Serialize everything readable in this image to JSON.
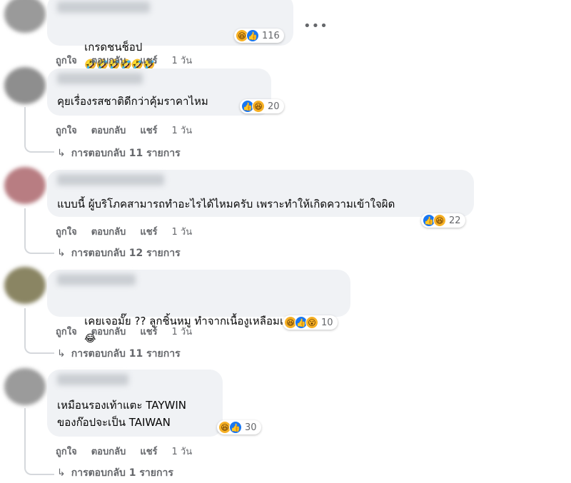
{
  "actions": {
    "like": "ถูกใจ",
    "reply": "ตอบกลับ",
    "share": "แชร์"
  },
  "comments": [
    {
      "text": "เกรดชนช็อป",
      "emoji": "🤣🤣🤣🤣🤣🤣",
      "reaction_count": "116",
      "time": "1 วัน",
      "replies": ""
    },
    {
      "text": "คุยเรื่องรสชาติดีกว่าคุ้มราคาไหม",
      "reaction_count": "20",
      "time": "1 วัน",
      "replies": "การตอบกลับ 11 รายการ"
    },
    {
      "text": "แบบนี้ ผู้บริโภคสามารถทำอะไรได้ไหมครับ เพราะทำให้เกิดความเข้าใจผิด",
      "reaction_count": "22",
      "time": "1 วัน",
      "replies": "การตอบกลับ 12 รายการ"
    },
    {
      "text": "เคยเจอมั๊ย ?? ลูกชิ้นหมู ทำจากเนื้องูเหลือมแท้ๆ",
      "emoji": "😂",
      "reaction_count": "10",
      "time": "1 วัน",
      "replies": "การตอบกลับ 11 รายการ"
    },
    {
      "text_line1": "เหมือนรองเท้าแตะ TAYWIN",
      "text_line2": "ของก๊อปจะเป็น TAIWAN",
      "reaction_count": "30",
      "time": "1 วัน",
      "replies": "การตอบกลับ 1 รายการ"
    }
  ],
  "colors": {
    "bubble": "#f0f2f5",
    "like": "#1877f2",
    "haha": "#f7b125",
    "meta": "#65676b"
  },
  "icons": [
    "like-icon",
    "haha-icon",
    "wow-icon",
    "reply-arrow-icon",
    "more-icon"
  ]
}
